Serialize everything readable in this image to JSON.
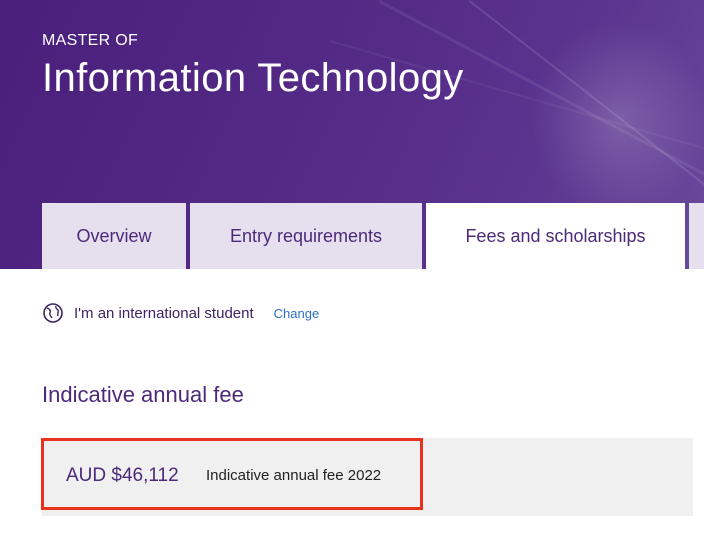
{
  "hero": {
    "kicker": "MASTER OF",
    "title": "Information Technology"
  },
  "tabs": [
    {
      "label": "Overview",
      "active": false
    },
    {
      "label": "Entry requirements",
      "active": false
    },
    {
      "label": "Fees and scholarships",
      "active": true
    },
    {
      "label": "",
      "active": false
    }
  ],
  "student": {
    "icon": "globe-icon",
    "label": "I'm an international student",
    "change_label": "Change"
  },
  "fees": {
    "heading": "Indicative annual fee",
    "amount": "AUD $46,112",
    "description": "Indicative annual fee 2022"
  },
  "colors": {
    "brand_purple": "#4b2a7a",
    "highlight_red": "#e8321e",
    "link_blue": "#2a6fc2"
  }
}
